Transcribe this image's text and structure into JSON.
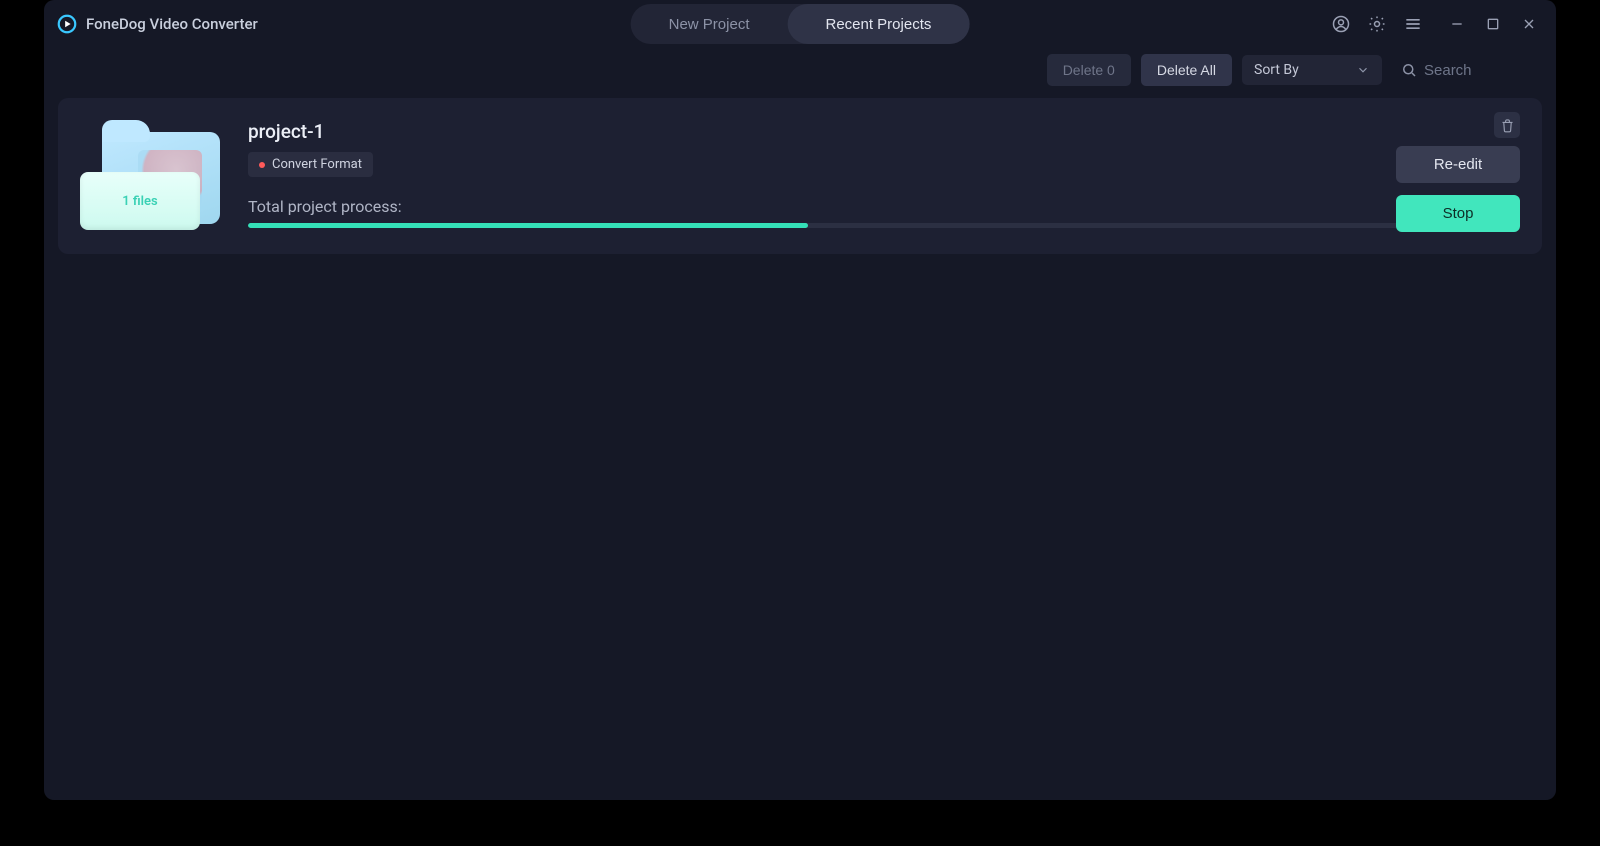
{
  "app": {
    "title": "FoneDog Video Converter"
  },
  "tabs": {
    "new_project": "New Project",
    "recent_projects": "Recent Projects"
  },
  "toolbar": {
    "delete_n": "Delete 0",
    "delete_all": "Delete All",
    "sort_by": "Sort By",
    "search_placeholder": "Search"
  },
  "project": {
    "name": "project-1",
    "tag": "Convert Format",
    "files_label": "1 files",
    "process_label": "Total project process:",
    "percent_text": "44.00%",
    "percent_value": 44,
    "reedit": "Re-edit",
    "stop": "Stop"
  }
}
